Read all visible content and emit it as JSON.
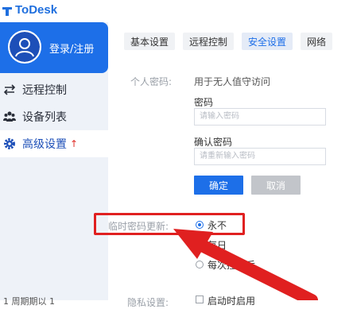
{
  "app": {
    "title": "ToDesk"
  },
  "sidebar": {
    "login_label": "登录/注册",
    "items": [
      {
        "label": "远程控制",
        "icon": "transfer-icon"
      },
      {
        "label": "设备列表",
        "icon": "devices-icon"
      },
      {
        "label": "高级设置",
        "icon": "gear-icon",
        "badge": "↑"
      }
    ],
    "bottom_partial": "1 周期期以 1"
  },
  "tabs": [
    {
      "label": "基本设置"
    },
    {
      "label": "远程控制"
    },
    {
      "label": "安全设置",
      "active": true
    },
    {
      "label": "网络"
    }
  ],
  "security": {
    "personal_password_label": "个人密码:",
    "personal_password_desc": "用于无人值守访问",
    "password_label": "密码",
    "password_placeholder": "请输入密码",
    "confirm_label": "确认密码",
    "confirm_placeholder": "请重新输入密码",
    "confirm_button": "确定",
    "cancel_button": "取消",
    "temp_password_label": "临时密码更新:",
    "temp_options": [
      "永不",
      "每日",
      "每次控制后"
    ],
    "selected_option": "永不",
    "privacy_label": "隐私设置:",
    "privacy_option": "启动时启用"
  },
  "colors": {
    "accent": "#1d6fe8",
    "annotation": "#e02020",
    "sidebar_bg": "#eef2f8"
  }
}
